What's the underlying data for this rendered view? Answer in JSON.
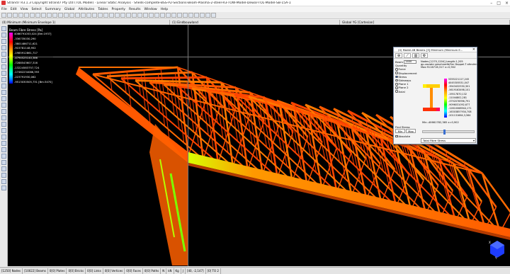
{
  "window": {
    "title": "Strand7 R3.1.3 Copyright Strand7 Pty Ltd (TOL Model) · Linear Static Analysis · Sheds-complete-BSS-P2-Sections-Beam-Plasma-2-steel-R3-TOW-Model-Dewar-TOL-Model-SB-15A-1",
    "controls": [
      "–",
      "□",
      "×"
    ]
  },
  "menu": [
    "File",
    "Edit",
    "View",
    "Select",
    "Summary",
    "Global",
    "Attributes",
    "Tables",
    "Property",
    "Results",
    "Window",
    "Help"
  ],
  "view_tabs": [
    {
      "label": "(0) Minimum (Minimum Envelope 1)"
    },
    {
      "label": "(1) Eindbouwland"
    },
    {
      "label": "Global YG [Cartesian]"
    }
  ],
  "legend": {
    "title": "Beam Fibre Stress  [Pa]",
    "values": [
      "4066791053,024 [Bm:1937]",
      "-336735030,290",
      "-3801486711,621",
      "-915781148,952",
      "-1985912861,717",
      "-4794525140,386",
      "-7288543607,316",
      "-13224583757,724",
      "-17462234086,393",
      "-223791930,062",
      "-9513030505,731 [Bm:3470]"
    ]
  },
  "dialog": {
    "title": "(0) Model-4B Beams [3] Minimum (Minimum E...",
    "tools": [
      "⊕",
      "⟋",
      "▥",
      "⚙"
    ],
    "beam_label": "Beam",
    "beam_value": "1400",
    "quantity_label": "Quantity",
    "quantities": [
      {
        "label": "Force",
        "on": false
      },
      {
        "label": "Displacement",
        "on": false
      },
      {
        "label": "Stress",
        "on": true
      },
      {
        "label": "Sideways",
        "on": false
      },
      {
        "label": "Plane 1",
        "on": false
      },
      {
        "label": "Plane 2",
        "on": false
      },
      {
        "label": "Axial",
        "on": false
      }
    ],
    "info_lines": [
      "Nodes [1270,1204]  Length:1,205",
      "gp-vouwbr geschroefd/Ser Doppel-T afmdrin HBS",
      "Max:9116716,317 x=0,902"
    ],
    "section_values": [
      "5355221117,245",
      "4045305531,047",
      "-3943432530,301",
      "-5619163498,101",
      "-19517870,132",
      "-11044802,281",
      "-3792076996,791",
      "-9096031092,677",
      "-12810068944,171",
      "-16303857934,708",
      "-201131664,3,564"
    ],
    "min_line": "Min:-40661782,365 x=0,902",
    "find_stress_label": "Find Stress",
    "min_label": "Min",
    "max_label": "Max",
    "absolute_label": "Absolute",
    "stress_type": "Total Fibre Stress"
  },
  "status": [
    "[1250] Nodes",
    "[10022] Beams",
    "0[0] Plates",
    "0[0] Bricks",
    "0[0] Links",
    "0[0] Vertices",
    "0[0] Faces",
    "0[0] Paths",
    "N",
    "kN",
    "Kg",
    "J",
    "[40, -2,147]",
    "[0] TO 2"
  ]
}
